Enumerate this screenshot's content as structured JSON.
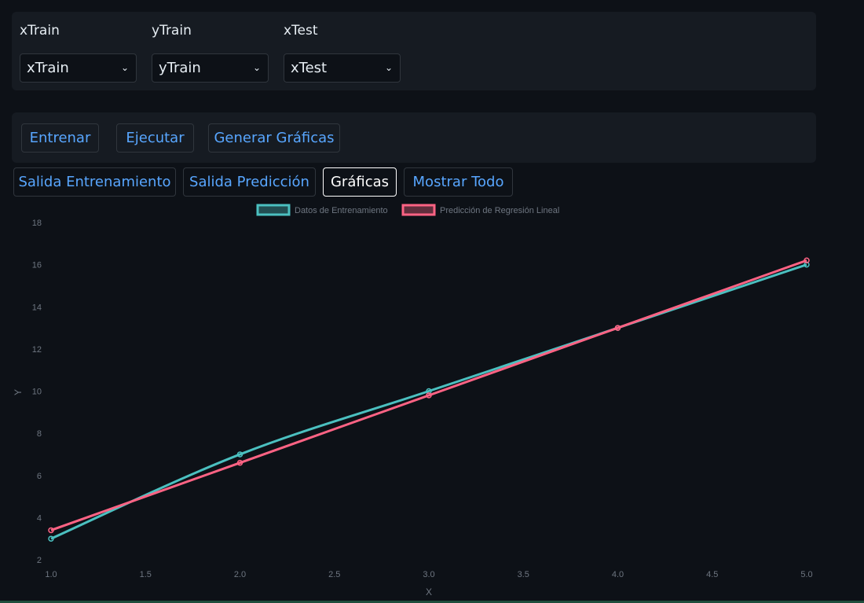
{
  "selectors": [
    {
      "label": "xTrain",
      "value": "xTrain"
    },
    {
      "label": "yTrain",
      "value": "yTrain"
    },
    {
      "label": "xTest",
      "value": "xTest"
    }
  ],
  "actions": {
    "train_label": "Entrenar",
    "execute_label": "Ejecutar",
    "charts_label": "Generar Gráficas"
  },
  "tabs": [
    {
      "label": "Salida Entrenamiento",
      "active": false
    },
    {
      "label": "Salida Predicción",
      "active": false
    },
    {
      "label": "Gráficas",
      "active": true
    },
    {
      "label": "Mostrar Todo",
      "active": false
    }
  ],
  "colors": {
    "training": "#4bc0c0",
    "prediction": "#ff6384",
    "link": "#58a6ff"
  },
  "chart_data": {
    "type": "line",
    "xlabel": "X",
    "ylabel": "Y",
    "xlim": [
      1.0,
      5.0
    ],
    "ylim": [
      2,
      18
    ],
    "xticks": [
      "1.0",
      "1.5",
      "2.0",
      "2.5",
      "3.0",
      "3.5",
      "4.0",
      "4.5",
      "5.0"
    ],
    "yticks": [
      "2",
      "4",
      "6",
      "8",
      "10",
      "12",
      "14",
      "16",
      "18"
    ],
    "legend_position": "top-center",
    "series": [
      {
        "name": "Datos de Entrenamiento",
        "x": [
          1,
          2,
          3,
          4,
          5
        ],
        "y": [
          3,
          7,
          10,
          13,
          16
        ]
      },
      {
        "name": "Predicción de Regresión Lineal",
        "x": [
          1,
          2,
          3,
          4,
          5
        ],
        "y": [
          3.4,
          6.6,
          9.8,
          13.0,
          16.2
        ]
      }
    ]
  }
}
